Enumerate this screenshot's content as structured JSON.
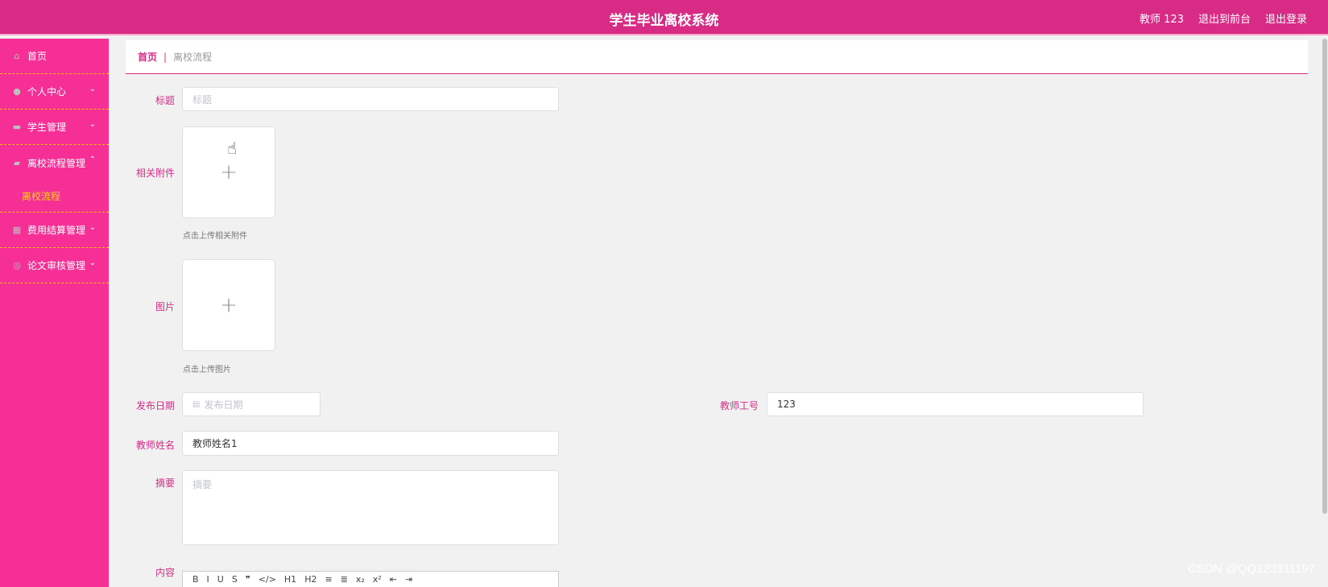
{
  "header": {
    "title": "学生毕业离校系统",
    "user": "教师 123",
    "to_front": "退出到前台",
    "logout": "退出登录"
  },
  "sidebar": {
    "items": [
      {
        "label": "首页",
        "icon": "home-icon"
      },
      {
        "label": "个人中心",
        "icon": "user-icon"
      },
      {
        "label": "学生管理",
        "icon": "briefcase-icon"
      },
      {
        "label": "离校流程管理",
        "icon": "ticket-icon"
      },
      {
        "label": "费用结算管理",
        "icon": "grid-icon"
      },
      {
        "label": "论文审核管理",
        "icon": "globe-icon"
      }
    ],
    "sub_active": "离校流程"
  },
  "breadcrumb": {
    "home": "首页",
    "sep": "|",
    "current": "离校流程"
  },
  "form": {
    "title_label": "标题",
    "title_placeholder": "标题",
    "attachment_label": "相关附件",
    "attachment_tip": "点击上传相关附件",
    "image_label": "图片",
    "image_tip": "点击上传图片",
    "date_label": "发布日期",
    "date_placeholder": "发布日期",
    "teacher_id_label": "教师工号",
    "teacher_id_value": "123",
    "teacher_name_label": "教师姓名",
    "teacher_name_value": "教师姓名1",
    "summary_label": "摘要",
    "summary_placeholder": "摘要",
    "content_label": "内容"
  },
  "editor_toolbar": [
    "B",
    "I",
    "U",
    "S",
    "❞",
    "</>",
    "H1",
    "H2",
    "≡",
    "≣",
    "x₂",
    "x²",
    "⇤",
    "⇥"
  ],
  "watermark": "CSDN @QQ123311197"
}
